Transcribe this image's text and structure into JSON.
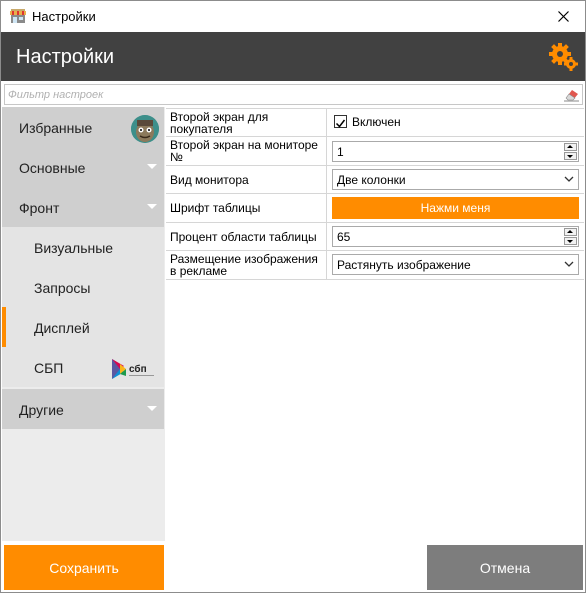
{
  "window": {
    "title": "Настройки",
    "close_icon": "close-icon"
  },
  "header": {
    "title": "Настройки",
    "icon": "gears-icon"
  },
  "filter": {
    "placeholder": "Фильтр настроек",
    "value": ""
  },
  "sidebar": {
    "items": [
      {
        "label": "Избранные",
        "type": "section"
      },
      {
        "label": "Основные",
        "type": "section"
      },
      {
        "label": "Фронт",
        "type": "section"
      },
      {
        "label": "Визуальные",
        "type": "sub"
      },
      {
        "label": "Запросы",
        "type": "sub"
      },
      {
        "label": "Дисплей",
        "type": "sub",
        "active": true
      },
      {
        "label": "СБП",
        "type": "sub"
      },
      {
        "label": "Другие",
        "type": "section"
      }
    ],
    "sbp_logo_text": "сбп"
  },
  "settings": {
    "rows": [
      {
        "label": "Второй экран для покупателя",
        "kind": "checkbox",
        "checked": true,
        "value": "Включен"
      },
      {
        "label": "Второй экран на мониторе №",
        "kind": "spin",
        "value": "1"
      },
      {
        "label": "Вид монитора",
        "kind": "select",
        "value": "Две колонки"
      },
      {
        "label": "Шрифт таблицы",
        "kind": "button",
        "value": "Нажми меня"
      },
      {
        "label": "Процент области таблицы",
        "kind": "spin",
        "value": "65"
      },
      {
        "label": "Размещение изображения в рекламе",
        "kind": "select",
        "value": "Растянуть изображение"
      }
    ]
  },
  "footer": {
    "save_label": "Сохранить",
    "cancel_label": "Отмена"
  },
  "colors": {
    "accent": "#ff8c00",
    "header_bg": "#414141",
    "cancel_bg": "#7d7d7d"
  }
}
